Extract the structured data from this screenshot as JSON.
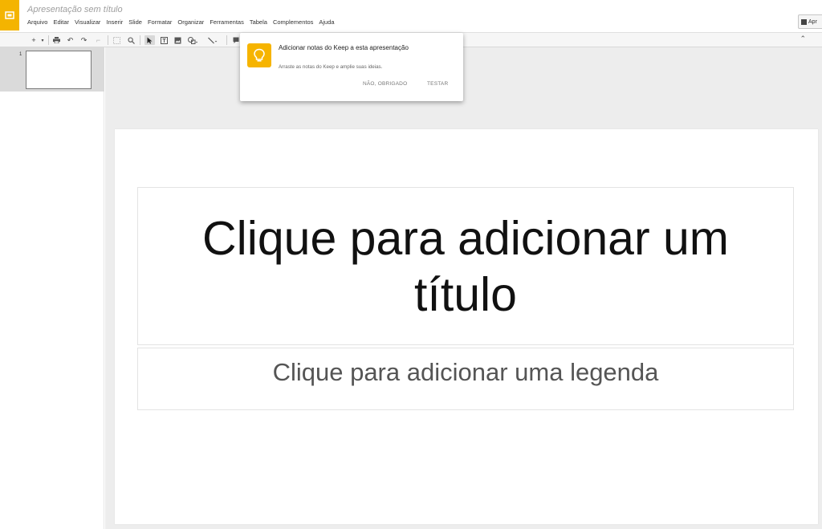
{
  "header": {
    "doc_title": "Apresentação sem título",
    "present_label": "Apr"
  },
  "menubar": [
    "Arquivo",
    "Editar",
    "Visualizar",
    "Inserir",
    "Slide",
    "Formatar",
    "Organizar",
    "Ferramentas",
    "Tabela",
    "Complementos",
    "Ajuda"
  ],
  "filmstrip": {
    "slide_number": "1"
  },
  "slide": {
    "title_placeholder": "Clique para adicionar um título",
    "subtitle_placeholder": "Clique para adicionar uma legenda"
  },
  "popup": {
    "title": "Adicionar notas do Keep a esta apresentação",
    "description": "Arraste as notas do Keep e amplie suas ideias.",
    "dismiss_label": "NÃO, OBRIGADO",
    "try_label": "TESTAR"
  },
  "colors": {
    "brand_yellow": "#f4b400",
    "selected_thumb_bg": "#dadada",
    "canvas_bg": "#ededed"
  },
  "icons": [
    "slides-logo-icon",
    "add-icon",
    "print-icon",
    "undo-icon",
    "redo-icon",
    "paint-format-icon",
    "zoom-fit-icon",
    "zoom-icon",
    "select-cursor-icon",
    "text-box-icon",
    "image-icon",
    "shape-icon",
    "line-icon",
    "comment-icon",
    "keep-bulb-icon",
    "collapse-icon",
    "present-icon"
  ]
}
